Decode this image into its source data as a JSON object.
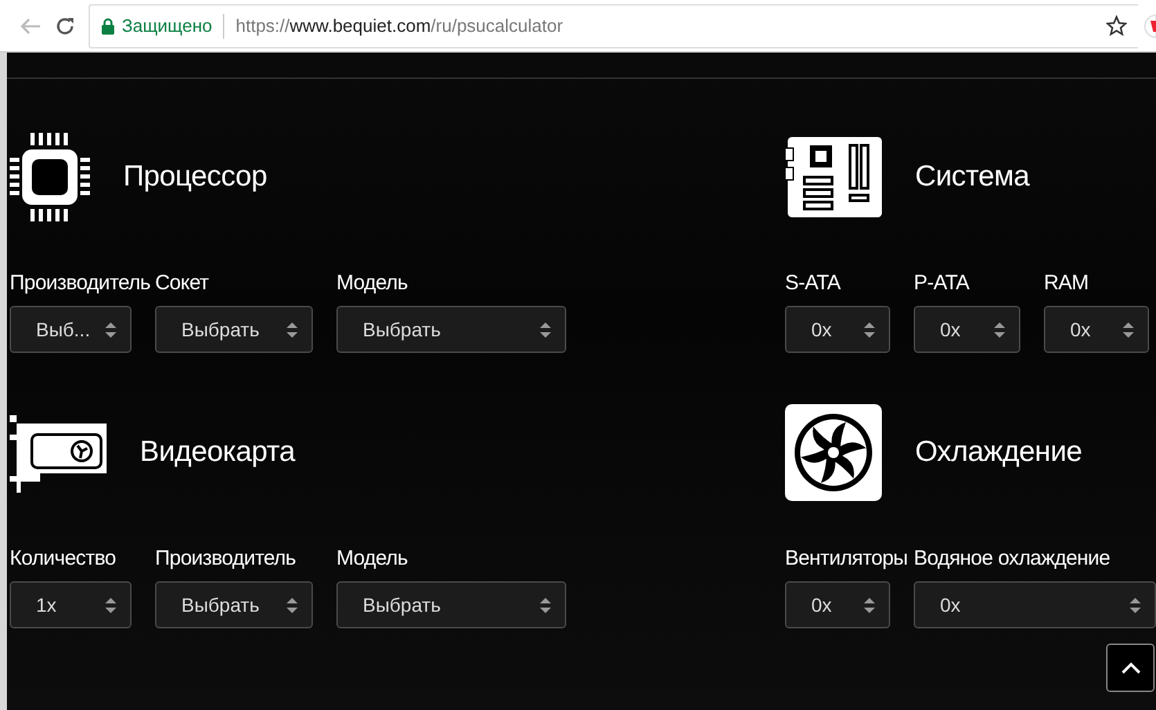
{
  "browser": {
    "secure_label": "Защищено",
    "url_scheme": "https://",
    "url_host": "www.bequiet.com",
    "url_path": "/ru/psucalculator",
    "back_disabled": true
  },
  "sections": [
    {
      "title": "Процессор",
      "kind": "cpu",
      "fields": [
        {
          "label": "Производитель",
          "value": "Выб..."
        },
        {
          "label": "Сокет",
          "value": "Выбрать"
        },
        {
          "label": "Модель",
          "value": "Выбрать"
        }
      ]
    },
    {
      "title": "Система",
      "kind": "board",
      "fields": [
        {
          "label": "S-ATA",
          "value": "0x"
        },
        {
          "label": "P-ATA",
          "value": "0x"
        },
        {
          "label": "RAM",
          "value": "0x"
        }
      ]
    },
    {
      "title": "Видеокарта",
      "kind": "gpu",
      "fields": [
        {
          "label": "Количество",
          "value": "1x"
        },
        {
          "label": "Производитель",
          "value": "Выбрать"
        },
        {
          "label": "Модель",
          "value": "Выбрать"
        }
      ]
    },
    {
      "title": "Охлаждение",
      "kind": "fan",
      "fields": [
        {
          "label": "Вентиляторы",
          "value": "0x"
        },
        {
          "label": "Водяное охлаждение",
          "value": "0x"
        }
      ]
    }
  ]
}
